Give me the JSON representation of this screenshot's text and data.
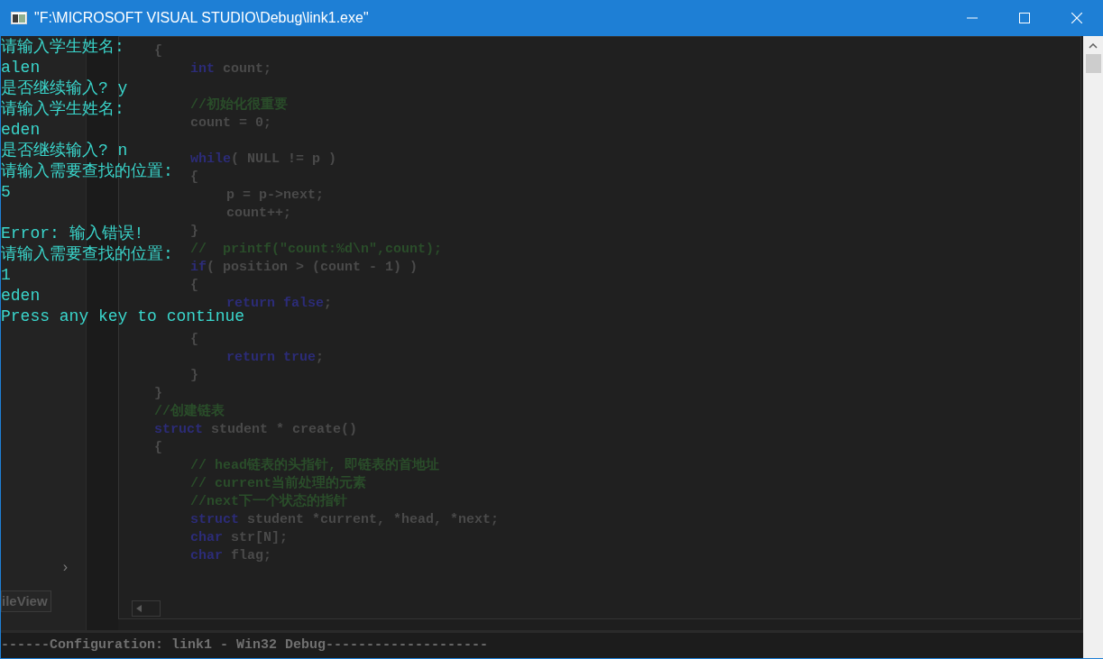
{
  "window": {
    "title": "\"F:\\MICROSOFT VISUAL STUDIO\\Debug\\link1.exe\""
  },
  "console": [
    {
      "kind": "text",
      "text": "请输入学生姓名:"
    },
    {
      "kind": "text",
      "text": "alen"
    },
    {
      "kind": "text",
      "text": "是否继续输入? y"
    },
    {
      "kind": "text",
      "text": "请输入学生姓名:"
    },
    {
      "kind": "text",
      "text": "eden"
    },
    {
      "kind": "text",
      "text": "是否继续输入? n"
    },
    {
      "kind": "text",
      "text": "请输入需要查找的位置:"
    },
    {
      "kind": "text",
      "text": "5"
    },
    {
      "kind": "blank"
    },
    {
      "kind": "text",
      "text": "Error: 输入错误!"
    },
    {
      "kind": "text",
      "text": "请输入需要查找的位置:"
    },
    {
      "kind": "text",
      "text": "1"
    },
    {
      "kind": "text",
      "text": "eden"
    },
    {
      "kind": "text",
      "text": "Press any key to continue"
    }
  ],
  "editor": {
    "code": [
      {
        "kind": "code",
        "segments": [
          {
            "kind": "plain",
            "text": "{"
          }
        ],
        "children": [
          {
            "kind": "code",
            "segments": [
              {
                "kind": "keyword",
                "text": "int"
              },
              {
                "kind": "plain",
                "text": " count;"
              }
            ]
          },
          {
            "kind": "blank"
          },
          {
            "kind": "code",
            "segments": [
              {
                "kind": "comment",
                "text": "//初始化很重要"
              }
            ]
          },
          {
            "kind": "code",
            "segments": [
              {
                "kind": "plain",
                "text": "count = 0;"
              }
            ]
          },
          {
            "kind": "blank"
          },
          {
            "kind": "code",
            "segments": [
              {
                "kind": "keyword",
                "text": "while"
              },
              {
                "kind": "plain",
                "text": "( NULL != p )"
              }
            ]
          },
          {
            "kind": "code",
            "segments": [
              {
                "kind": "plain",
                "text": "{"
              }
            ],
            "children": [
              {
                "kind": "code",
                "segments": [
                  {
                    "kind": "plain",
                    "text": "p = p->next;"
                  }
                ]
              },
              {
                "kind": "code",
                "segments": [
                  {
                    "kind": "plain",
                    "text": "count++;"
                  }
                ]
              }
            ]
          },
          {
            "kind": "code",
            "segments": [
              {
                "kind": "plain",
                "text": "}"
              }
            ]
          },
          {
            "kind": "code",
            "segments": [
              {
                "kind": "comment",
                "text": "//  printf(\"count:%d\\n\",count);"
              }
            ]
          },
          {
            "kind": "code",
            "segments": [
              {
                "kind": "keyword",
                "text": "if"
              },
              {
                "kind": "plain",
                "text": "( position > (count - 1) )"
              }
            ]
          },
          {
            "kind": "code",
            "segments": [
              {
                "kind": "plain",
                "text": "{"
              }
            ],
            "children": [
              {
                "kind": "code",
                "segments": [
                  {
                    "kind": "keyword",
                    "text": "return false"
                  },
                  {
                    "kind": "plain",
                    "text": ";"
                  }
                ]
              }
            ]
          },
          {
            "kind": "blank"
          },
          {
            "kind": "code",
            "segments": [
              {
                "kind": "plain",
                "text": "{"
              }
            ],
            "children": [
              {
                "kind": "code",
                "segments": [
                  {
                    "kind": "keyword",
                    "text": "return true"
                  },
                  {
                    "kind": "plain",
                    "text": ";"
                  }
                ]
              }
            ]
          },
          {
            "kind": "code",
            "segments": [
              {
                "kind": "plain",
                "text": "}"
              }
            ]
          }
        ]
      },
      {
        "kind": "code",
        "segments": [
          {
            "kind": "plain",
            "text": "}"
          }
        ]
      },
      {
        "kind": "code",
        "segments": [
          {
            "kind": "comment",
            "text": "//创建链表"
          }
        ]
      },
      {
        "kind": "code",
        "segments": [
          {
            "kind": "keyword",
            "text": "struct"
          },
          {
            "kind": "plain",
            "text": " student * create()"
          }
        ]
      },
      {
        "kind": "code",
        "segments": [
          {
            "kind": "plain",
            "text": "{"
          }
        ],
        "children": [
          {
            "kind": "code",
            "segments": [
              {
                "kind": "comment",
                "text": "// head链表的头指针, 即链表的首地址"
              }
            ]
          },
          {
            "kind": "code",
            "segments": [
              {
                "kind": "comment",
                "text": "// current当前处理的元素"
              }
            ]
          },
          {
            "kind": "code",
            "segments": [
              {
                "kind": "comment",
                "text": "//next下一个状态的指针"
              }
            ]
          },
          {
            "kind": "code",
            "segments": [
              {
                "kind": "keyword",
                "text": "struct"
              },
              {
                "kind": "plain",
                "text": " student *current, *head, *next;"
              }
            ]
          },
          {
            "kind": "code",
            "segments": [
              {
                "kind": "keyword",
                "text": "char"
              },
              {
                "kind": "plain",
                "text": " str[N];"
              }
            ]
          },
          {
            "kind": "code",
            "segments": [
              {
                "kind": "keyword",
                "text": "char"
              },
              {
                "kind": "plain",
                "text": " flag;"
              }
            ]
          }
        ]
      }
    ]
  },
  "sidebar": {
    "tab": "ileView",
    "scroll_arrow": "›"
  },
  "output": {
    "text": "------Configuration: link1 - Win32 Debug--------------------"
  }
}
